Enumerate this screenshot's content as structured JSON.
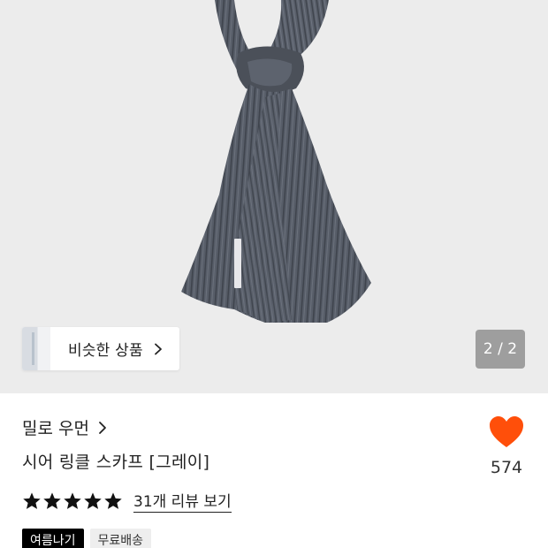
{
  "gallery": {
    "similar_label": "비슷한 상품",
    "page_counter": "2 / 2"
  },
  "product": {
    "brand": "밀로 우먼",
    "title": "시어 링클 스카프 [그레이]",
    "likes": "574",
    "rating": 5,
    "review_link": "31개 리뷰 보기",
    "tags": [
      "여름나기",
      "무료배송"
    ]
  },
  "icons": {
    "heart": "heart-icon",
    "star": "star-icon",
    "chevron": "chevron-right-icon"
  },
  "colors": {
    "heart": "#ff4f0a",
    "tag_dark": "#000000",
    "scarf": "#555b66"
  }
}
